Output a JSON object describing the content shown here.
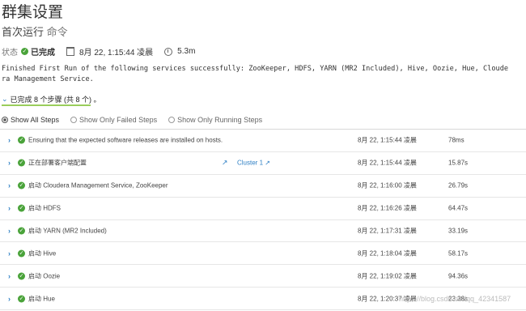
{
  "page": {
    "title": "群集设置",
    "subtitle_prefix": "首次运行",
    "subtitle_cmd": "命令"
  },
  "status": {
    "label": "状态",
    "value": "已完成",
    "datetime": "8月 22, 1:15:44 凌晨",
    "duration": "5.3m"
  },
  "message": "Finished First Run of the following services successfully: ZooKeeper, HDFS, YARN (MR2 Included), Hive, Oozie, Hue, Cloudera Management Service.",
  "steps_summary": "已完成 8 个步骤 (共 8 个) 。",
  "filters": [
    {
      "label": "Show All Steps",
      "selected": true
    },
    {
      "label": "Show Only Failed Steps",
      "selected": false
    },
    {
      "label": "Show Only Running Steps",
      "selected": false
    }
  ],
  "steps": [
    {
      "name": "Ensuring that the expected software releases are installed on hosts.",
      "cluster": "",
      "time": "8月 22, 1:15:44 凌晨",
      "duration": "78ms"
    },
    {
      "name": "正在部署客户端配置",
      "cluster": "Cluster 1",
      "time": "8月 22, 1:15:44 凌晨",
      "duration": "15.87s"
    },
    {
      "name": "启动 Cloudera Management Service, ZooKeeper",
      "cluster": "",
      "time": "8月 22, 1:16:00 凌晨",
      "duration": "26.79s"
    },
    {
      "name": "启动 HDFS",
      "cluster": "",
      "time": "8月 22, 1:16:26 凌晨",
      "duration": "64.47s"
    },
    {
      "name": "启动 YARN (MR2 Included)",
      "cluster": "",
      "time": "8月 22, 1:17:31 凌晨",
      "duration": "33.19s"
    },
    {
      "name": "启动 Hive",
      "cluster": "",
      "time": "8月 22, 1:18:04 凌晨",
      "duration": "58.17s"
    },
    {
      "name": "启动 Oozie",
      "cluster": "",
      "time": "8月 22, 1:19:02 凌晨",
      "duration": "94.36s"
    },
    {
      "name": "启动 Hue",
      "cluster": "",
      "time": "8月 22, 1:20:37 凌晨",
      "duration": "23.38s"
    }
  ],
  "watermark": "https://blog.csdn.net/qq_42341587",
  "colors": {
    "success": "#4aa33a",
    "link": "#2d7fc4",
    "accent_underline": "#9acd5b"
  }
}
